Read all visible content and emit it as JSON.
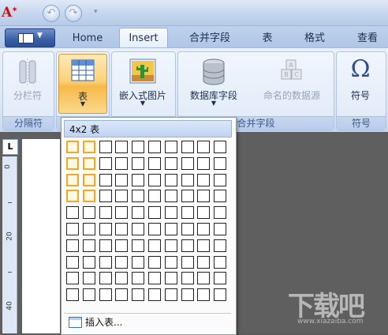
{
  "app": {
    "logo": "A"
  },
  "tabs": [
    {
      "label": "Home",
      "active": false
    },
    {
      "label": "Insert",
      "active": true
    },
    {
      "label": "合并字段",
      "active": false
    },
    {
      "label": "表",
      "active": false
    },
    {
      "label": "格式",
      "active": false
    },
    {
      "label": "查看",
      "active": false
    }
  ],
  "ribbon": {
    "groups": [
      {
        "label": "分隔符",
        "buttons": [
          {
            "label": "分栏符",
            "enabled": false
          }
        ]
      },
      {
        "label": "",
        "buttons": [
          {
            "label": "表",
            "enabled": true,
            "highlighted": true
          }
        ]
      },
      {
        "label": "",
        "buttons": [
          {
            "label": "嵌入式图片",
            "enabled": true
          }
        ]
      },
      {
        "label": "合并字段",
        "buttons": [
          {
            "label": "数据库字段",
            "enabled": true
          },
          {
            "label": "命名的数据源",
            "enabled": false
          }
        ]
      },
      {
        "label": "符号",
        "buttons": [
          {
            "label": "符号",
            "enabled": true
          }
        ]
      }
    ]
  },
  "ruler": {
    "marks": [
      "0",
      "20",
      "40"
    ]
  },
  "table_menu": {
    "header": "4x2 表",
    "grid": {
      "columns": 10,
      "rows": 10,
      "selected_columns": 2,
      "selected_rows": 4
    },
    "insert_label": "插入表..."
  },
  "watermark": {
    "text": "下载吧",
    "sub": "www.xiazaiba.com"
  },
  "colors": {
    "selection": "#f3a927",
    "ribbon": "#dbe6f6",
    "highlight": "#fbd27a"
  }
}
